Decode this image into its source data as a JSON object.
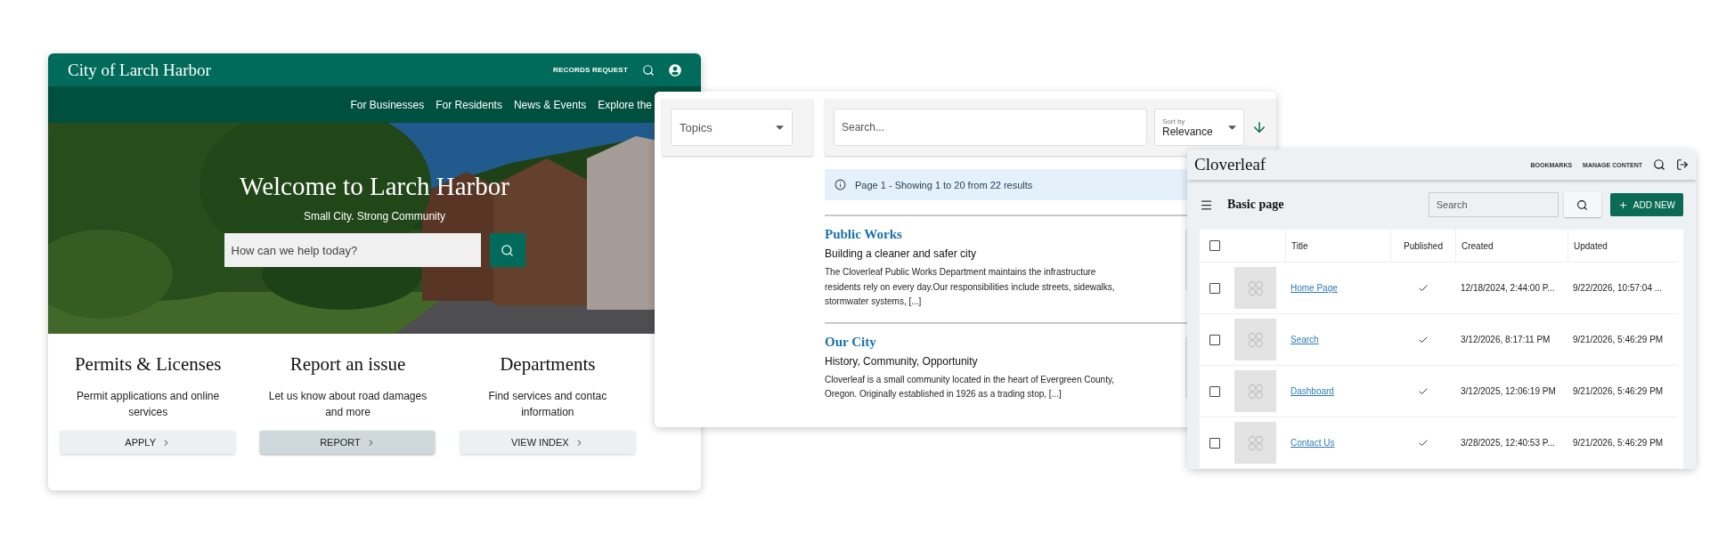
{
  "site": {
    "title": "City of Larch Harbor",
    "header_link": "RECORDS REQUEST",
    "nav": [
      "For Businesses",
      "For Residents",
      "News & Events",
      "Explore the"
    ],
    "hero": {
      "title": "Welcome to Larch Harbor",
      "subtitle": "Small City. Strong Community",
      "search": {
        "placeholder": "How can we help today?"
      }
    },
    "cards": [
      {
        "title": "Permits & Licenses",
        "lines": [
          "Permit applications and online",
          "services"
        ],
        "button": "APPLY",
        "highlighted": false
      },
      {
        "title": "Report an issue",
        "lines": [
          "Let us know about road damages",
          "and more"
        ],
        "button": "REPORT",
        "highlighted": true
      },
      {
        "title": "Departments",
        "lines": [
          "Find services and contac",
          "information"
        ],
        "button": "VIEW INDEX",
        "highlighted": false
      }
    ]
  },
  "search_page": {
    "topics": {
      "label": "Topics"
    },
    "search": {
      "placeholder": "Search..."
    },
    "sort": {
      "label": "Sort by",
      "value": "Relevance"
    },
    "info": "Page 1 - Showing 1 to 20 from 22 results",
    "results": [
      {
        "title": "Public Works",
        "subtitle": "Building a cleaner and safer city",
        "text": "The Cloverleaf Public Works Department maintains the infrastructure residents rely on every day.Our responsibilities include streets, sidewalks, stormwater systems, [...]"
      },
      {
        "title": "Our City",
        "subtitle": "History, Community, Opportunity",
        "text": "Cloverleaf is a small community located in the heart of Evergreen County, Oregon. Originally established in 1926 as a trading stop, [...]"
      }
    ]
  },
  "admin": {
    "brand": "Cloverleaf",
    "nav": [
      "BOOKMARKS",
      "MANAGE CONTENT"
    ],
    "page_title": "Basic page",
    "search": {
      "placeholder": "Search"
    },
    "add_button": "ADD NEW",
    "columns": [
      "Title",
      "Published",
      "Created",
      "Updated"
    ],
    "header_checked": false,
    "rows": [
      {
        "title": "Home Page",
        "published": true,
        "created": "12/18/2024, 2:44:00 P...",
        "updated": "9/22/2026, 10:57:04 ...",
        "checked": false
      },
      {
        "title": "Search",
        "published": true,
        "created": "3/12/2026, 8:17:11 PM",
        "updated": "9/21/2026, 5:46:29 PM",
        "checked": false
      },
      {
        "title": "Dashboard",
        "published": true,
        "created": "3/12/2025, 12:06:19 PM",
        "updated": "9/21/2026, 5:46:29 PM",
        "checked": false
      },
      {
        "title": "Contact Us",
        "published": true,
        "created": "3/28/2025, 12:40:53 P...",
        "updated": "9/21/2026, 5:46:29 PM",
        "checked": false
      }
    ]
  }
}
